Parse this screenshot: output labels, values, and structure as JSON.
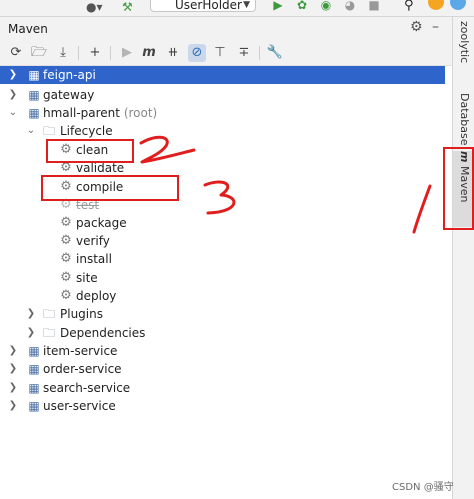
{
  "topbar": {
    "run_config": "UserHolder"
  },
  "tool_window": {
    "title": "Maven"
  },
  "tree": {
    "projects": [
      {
        "label": "feign-api",
        "selected": true
      },
      {
        "label": "gateway"
      },
      {
        "label": "hmall-parent",
        "suffix": "(root)"
      },
      {
        "label": "item-service"
      },
      {
        "label": "order-service"
      },
      {
        "label": "search-service"
      },
      {
        "label": "user-service"
      }
    ],
    "lifecycle_label": "Lifecycle",
    "lifecycle": [
      "clean",
      "validate",
      "compile",
      "test",
      "package",
      "verify",
      "install",
      "site",
      "deploy"
    ],
    "plugins_label": "Plugins",
    "dependencies_label": "Dependencies"
  },
  "right_tabs": {
    "zoolytic": "zoolytic",
    "database": "Database",
    "maven": "Maven"
  },
  "annotations": {
    "mark_1": "1",
    "mark_2": "2",
    "mark_3": "3",
    "color": "#e01e1e"
  },
  "watermark": "CSDN @骚守"
}
